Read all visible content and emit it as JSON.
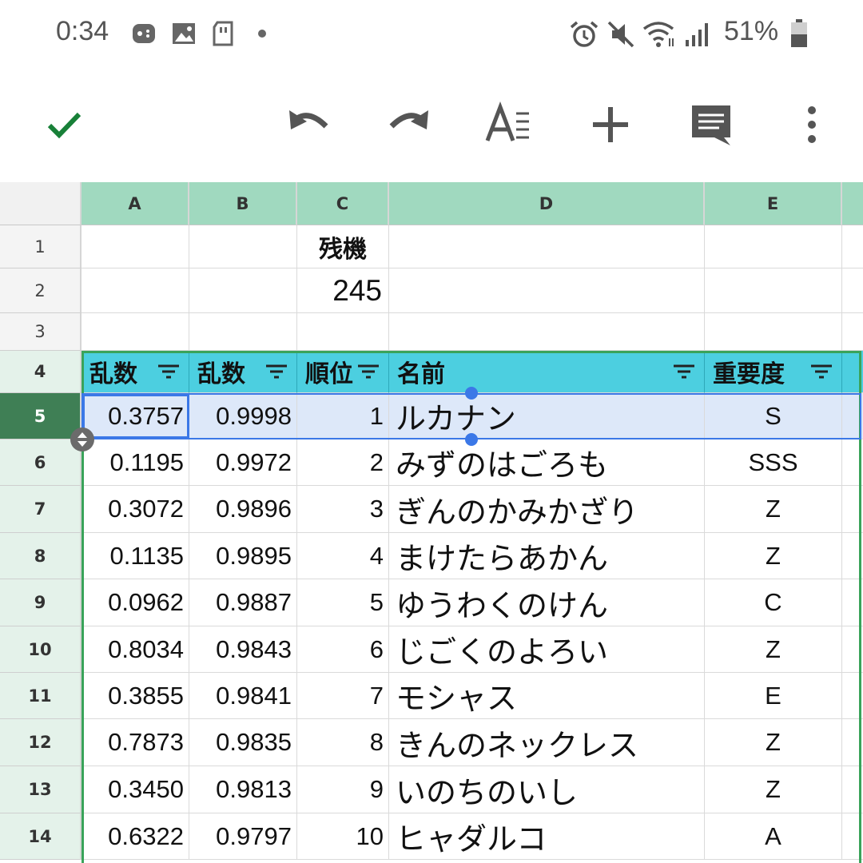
{
  "status_bar": {
    "time": "0:34",
    "battery": "51%",
    "left_icons": [
      "game-icon",
      "image-icon",
      "sd-card-icon",
      "dot-icon"
    ],
    "right_icons": [
      "alarm-icon",
      "mute-icon",
      "wifi-icon",
      "signal-icon",
      "battery-icon"
    ]
  },
  "toolbar": {
    "icons": [
      "check-icon",
      "undo-icon",
      "redo-icon",
      "text-format-icon",
      "add-icon",
      "comment-icon",
      "more-icon"
    ],
    "accent": "#188038"
  },
  "sheet": {
    "columns": [
      "A",
      "B",
      "C",
      "D",
      "E"
    ],
    "row_numbers": [
      "1",
      "2",
      "3",
      "4",
      "5",
      "6",
      "7",
      "8",
      "9",
      "10",
      "11",
      "12",
      "13",
      "14"
    ],
    "c1": "残機",
    "c2": "245",
    "header_row": [
      "乱数",
      "乱数",
      "順位",
      "名前",
      "重要度"
    ],
    "rows": [
      [
        "0.3757",
        "0.9998",
        "1",
        "ルカナン",
        "S"
      ],
      [
        "0.1195",
        "0.9972",
        "2",
        "みずのはごろも",
        "SSS"
      ],
      [
        "0.3072",
        "0.9896",
        "3",
        "ぎんのかみかざり",
        "Z"
      ],
      [
        "0.1135",
        "0.9895",
        "4",
        "まけたらあかん",
        "Z"
      ],
      [
        "0.0962",
        "0.9887",
        "5",
        "ゆうわくのけん",
        "C"
      ],
      [
        "0.8034",
        "0.9843",
        "6",
        "じごくのよろい",
        "Z"
      ],
      [
        "0.3855",
        "0.9841",
        "7",
        "モシャス",
        "E"
      ],
      [
        "0.7873",
        "0.9835",
        "8",
        "きんのネックレス",
        "Z"
      ],
      [
        "0.3450",
        "0.9813",
        "9",
        "いのちのいし",
        "Z"
      ],
      [
        "0.6322",
        "0.9797",
        "10",
        "ヒャダルコ",
        "A"
      ]
    ],
    "colors": {
      "column_header": "#a0d9bf",
      "table_header": "#4ccfe0",
      "selection": "#dde8f9",
      "selection_border": "#3b78e7",
      "active_row_header": "#3f7f55"
    }
  }
}
